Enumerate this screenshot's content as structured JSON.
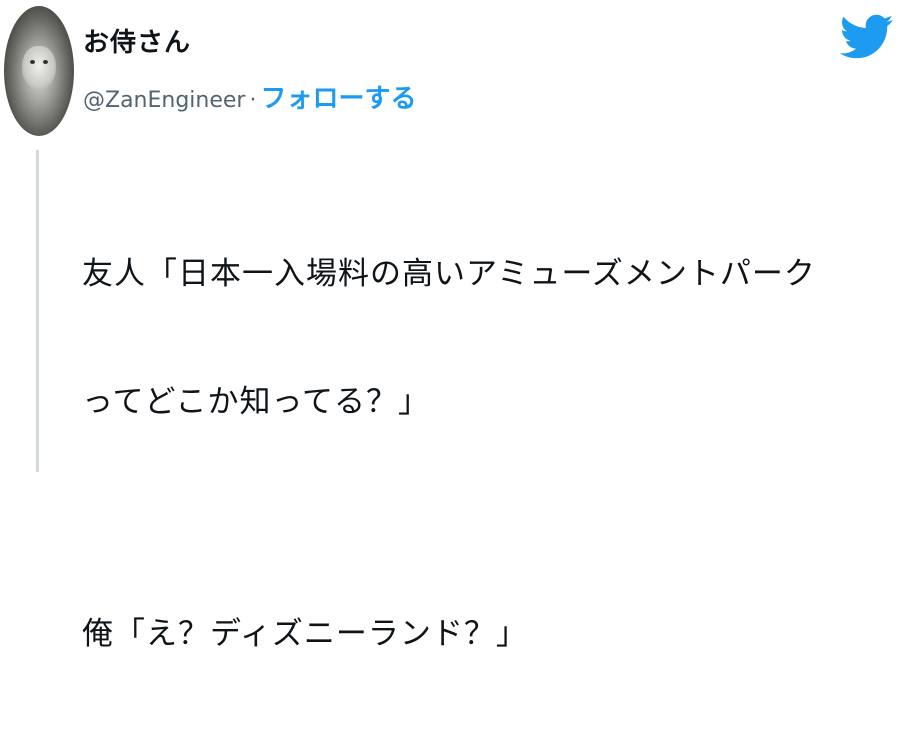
{
  "author": {
    "display_name": "お侍さん",
    "handle": "@ZanEngineer",
    "separator": "·",
    "follow_label": "フォローする"
  },
  "icons": {
    "brand": "twitter-bird-icon",
    "avatar": "avatar-image"
  },
  "tweet": {
    "line1": "友人「日本一入場料の高いアミューズメントパーク",
    "line2": "ってどこか知ってる？」",
    "line3": "俺「え？ディズニーランド？」"
  },
  "colors": {
    "accent": "#1d9bf0",
    "text": "#0f1419",
    "muted": "#536471",
    "thread_line": "#cfd9de"
  }
}
